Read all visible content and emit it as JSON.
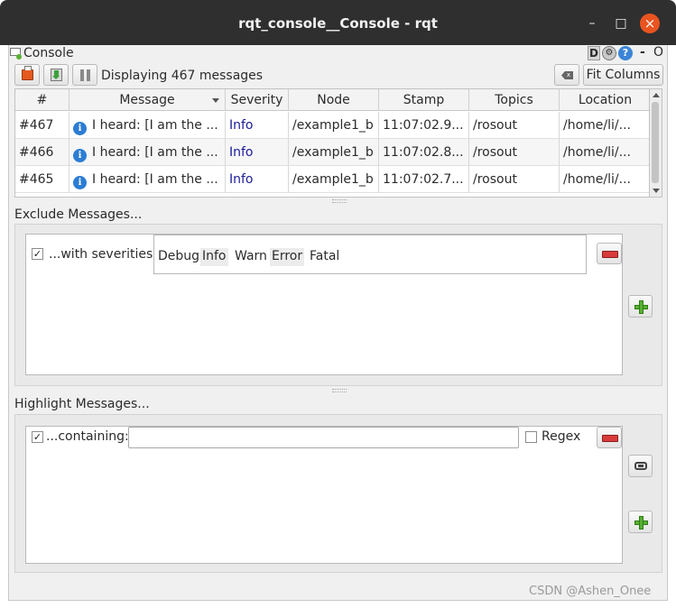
{
  "window": {
    "title": "rqt_console__Console - rqt",
    "minimize_glyph": "–",
    "maximize_glyph": "□",
    "close_glyph": "×"
  },
  "dock": {
    "title": "Console",
    "d_label": "D",
    "gear_label": "⚙",
    "help_label": "?",
    "minimize_label": "-",
    "close_label": "O"
  },
  "toolbar": {
    "status_text": "Displaying 467 messages",
    "fit_columns_label": "Fit Columns",
    "clear_label": "x"
  },
  "table": {
    "columns": [
      "#",
      "Message",
      "Severity",
      "Node",
      "Stamp",
      "Topics",
      "Location"
    ],
    "rows": [
      {
        "num": "#467",
        "message": "I heard: [I am the ...",
        "severity": "Info",
        "node": "/example1_b",
        "stamp": "11:07:02.9...",
        "topics": "/rosout",
        "location": "/home/li/..."
      },
      {
        "num": "#466",
        "message": "I heard: [I am the ...",
        "severity": "Info",
        "node": "/example1_b",
        "stamp": "11:07:02.8...",
        "topics": "/rosout",
        "location": "/home/li/..."
      },
      {
        "num": "#465",
        "message": "I heard: [I am the ...",
        "severity": "Info",
        "node": "/example1_b",
        "stamp": "11:07:02.7...",
        "topics": "/rosout",
        "location": "/home/li/..."
      }
    ],
    "info_icon_glyph": "i"
  },
  "exclude": {
    "title": "Exclude Messages...",
    "checkbox_mark": "✓",
    "filter_label": "...with severities:",
    "severities": [
      {
        "label": "Debug",
        "selected": false
      },
      {
        "label": "Info",
        "selected": true
      },
      {
        "label": "Warn",
        "selected": false
      },
      {
        "label": "Error",
        "selected": true
      },
      {
        "label": "Fatal",
        "selected": false
      }
    ]
  },
  "highlight": {
    "title": "Highlight Messages...",
    "checkbox_mark": "✓",
    "filter_label": "...containing:",
    "text_value": "",
    "regex_label": "Regex"
  },
  "watermark": "CSDN @Ashen_Onee"
}
